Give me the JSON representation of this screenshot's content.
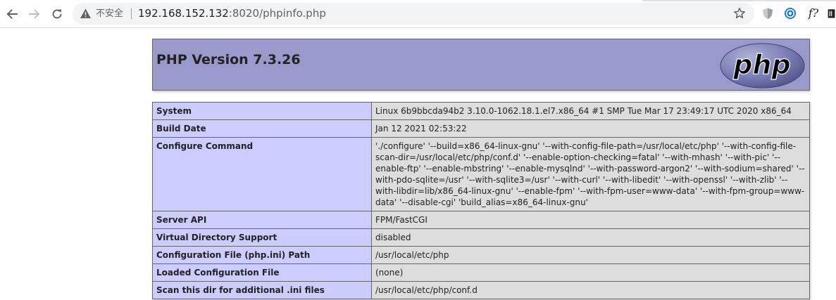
{
  "browser": {
    "security_label": "不安全",
    "url_host": "192.168.152.132",
    "url_rest": ":8020/phpinfo.php",
    "ext_f_label": "f?",
    "accent": "#1a73e8"
  },
  "page": {
    "title": "PHP Version 7.3.26",
    "logo_text": "php",
    "colors": {
      "header_bg": "#9999cc",
      "label_bg": "#ccccff",
      "value_bg": "#dddddd"
    },
    "rows": [
      {
        "label": "System",
        "value": "Linux 6b9bbcda94b2 3.10.0-1062.18.1.el7.x86_64 #1 SMP Tue Mar 17 23:49:17 UTC 2020 x86_64"
      },
      {
        "label": "Build Date",
        "value": "Jan 12 2021 02:53:22"
      },
      {
        "label": "Configure Command",
        "value": "'./configure' '--build=x86_64-linux-gnu' '--with-config-file-path=/usr/local/etc/php' '--with-config-file-scan-dir=/usr/local/etc/php/conf.d' '--enable-option-checking=fatal' '--with-mhash' '--with-pic' '--enable-ftp' '--enable-mbstring' '--enable-mysqlnd' '--with-password-argon2' '--with-sodium=shared' '--with-pdo-sqlite=/usr' '--with-sqlite3=/usr' '--with-curl' '--with-libedit' '--with-openssl' '--with-zlib' '--with-libdir=lib/x86_64-linux-gnu' '--enable-fpm' '--with-fpm-user=www-data' '--with-fpm-group=www-data' '--disable-cgi' 'build_alias=x86_64-linux-gnu'"
      },
      {
        "label": "Server API",
        "value": "FPM/FastCGI"
      },
      {
        "label": "Virtual Directory Support",
        "value": "disabled"
      },
      {
        "label": "Configuration File (php.ini) Path",
        "value": "/usr/local/etc/php"
      },
      {
        "label": "Loaded Configuration File",
        "value": "(none)"
      },
      {
        "label": "Scan this dir for additional .ini files",
        "value": "/usr/local/etc/php/conf.d"
      }
    ]
  }
}
